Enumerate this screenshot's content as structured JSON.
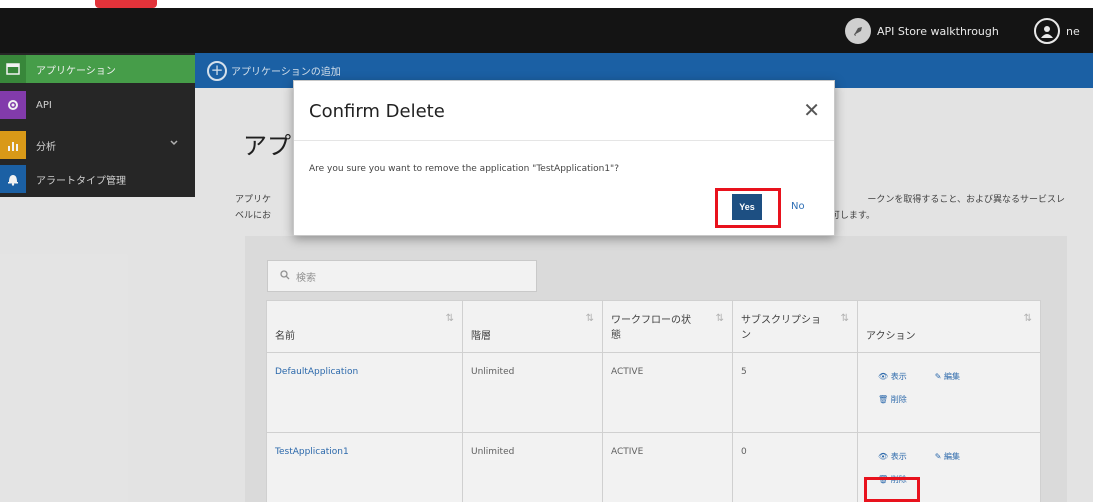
{
  "header": {
    "walkthrough_label": "API Store walkthrough",
    "user_label": "ne"
  },
  "sidebar": {
    "items": [
      {
        "label": "アプリケーション",
        "icon": "application-icon",
        "color": "#4aa64d",
        "active": true
      },
      {
        "label": "API",
        "icon": "gear-icon",
        "color": "#8a3fb5"
      },
      {
        "label": "分析",
        "icon": "chart-icon",
        "color": "#e5a21a"
      },
      {
        "label": "アラートタイプ管理",
        "icon": "bell-icon",
        "color": "#1d66ad"
      }
    ]
  },
  "toolbar": {
    "add_label": "アプリケーションの追加"
  },
  "content": {
    "page_title": "アプ",
    "desc_line1": "アプリケ",
    "desc_line2": "ベルにお",
    "desc_right1": "ークンを取得すること、および異なるサービスレ",
    "desc_right2": "制限のアクセスを許可します。",
    "search_placeholder": "検索"
  },
  "table": {
    "headers": [
      "名前",
      "階層",
      "ワークフローの状態",
      "サブスクリプション",
      "アクション"
    ],
    "header_lines": [
      [
        "ワークフローの状",
        "態"
      ],
      [
        "サブスクリプショ",
        "ン"
      ]
    ],
    "rows": [
      {
        "name": "DefaultApplication",
        "tier": "Unlimited",
        "workflow": "ACTIVE",
        "subscriptions": "5"
      },
      {
        "name": "TestApplication1",
        "tier": "Unlimited",
        "workflow": "ACTIVE",
        "subscriptions": "0"
      }
    ],
    "actions": {
      "view": "表示",
      "edit": "編集",
      "delete": "削除"
    }
  },
  "modal": {
    "title": "Confirm Delete",
    "message": "Are you sure you want to remove the application \"TestApplication1\"?",
    "yes_label": "Yes",
    "no_label": "No",
    "highlight_color": "#e8121d"
  }
}
